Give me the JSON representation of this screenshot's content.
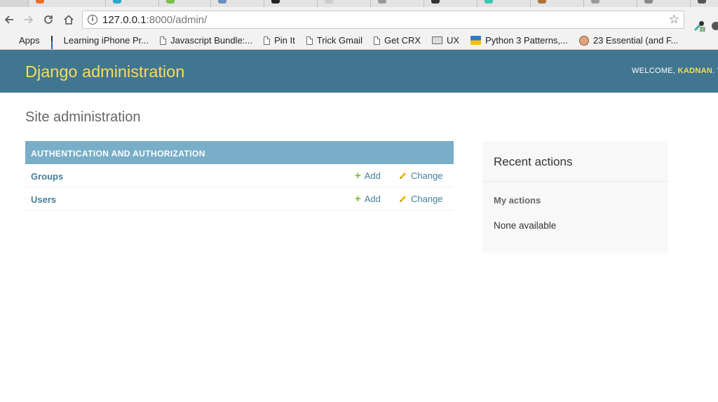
{
  "browser": {
    "address_host": "127.0.0.1",
    "address_rest": ":8000/admin/",
    "bookmarks": [
      {
        "label": "Apps",
        "icon": "apps-grid-icon"
      },
      {
        "label": "Learning iPhone Pr...",
        "icon": "bars-icon"
      },
      {
        "label": "Javascript Bundle:...",
        "icon": "page-icon"
      },
      {
        "label": "Pin It",
        "icon": "page-icon"
      },
      {
        "label": "Trick Gmail",
        "icon": "page-icon"
      },
      {
        "label": "Get CRX",
        "icon": "page-icon"
      },
      {
        "label": "UX",
        "icon": "folder-icon"
      },
      {
        "label": "Python 3 Patterns,...",
        "icon": "python-icon"
      },
      {
        "label": "23 Essential (and F...",
        "icon": "face-icon"
      }
    ]
  },
  "admin": {
    "branding": "Django administration",
    "welcome_label": "WELCOME,",
    "username": "KADNAN",
    "user_tools_rest": ". V",
    "page_title": "Site administration",
    "app_caption": "AUTHENTICATION AND AUTHORIZATION",
    "models": [
      {
        "name": "Groups",
        "add": "Add",
        "change": "Change"
      },
      {
        "name": "Users",
        "add": "Add",
        "change": "Change"
      }
    ],
    "recent_actions": {
      "title": "Recent actions",
      "subtitle": "My actions",
      "empty": "None available"
    }
  },
  "colors": {
    "header_bg": "#417690",
    "branding": "#f5dd5d",
    "caption_bg": "#79aec8",
    "link": "#447e9b",
    "add_icon": "#70bf2b",
    "change_icon": "#efb80b"
  }
}
